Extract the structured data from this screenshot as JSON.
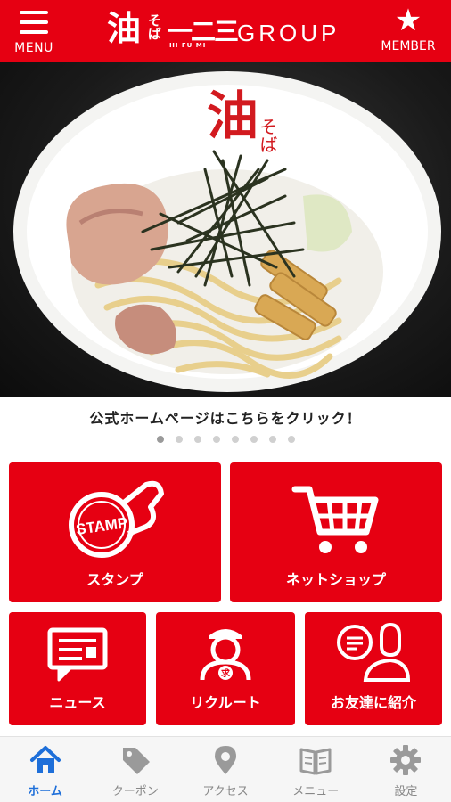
{
  "header": {
    "menu_label": "MENU",
    "logo_kanji": "油",
    "logo_sub": "そば",
    "logo_number": "一二三",
    "logo_romaji": "HI FU MI",
    "logo_group": "GROUP",
    "member_label": "MEMBER",
    "bg_color": "#e60012"
  },
  "hero": {
    "bowl_text_kanji": "油",
    "bowl_text_kana": "そば"
  },
  "banner": {
    "caption": "公式ホームページはこちらをクリック！",
    "dots_total": 8,
    "dots_active": 0
  },
  "tiles": {
    "stamp": {
      "label": "スタンプ",
      "icon_text": "STAMP"
    },
    "shop": {
      "label": "ネットショップ"
    },
    "news": {
      "label": "ニュース"
    },
    "recruit": {
      "label": "リクルート",
      "icon_text": "求"
    },
    "invite": {
      "label": "お友達に紹介"
    }
  },
  "nav": {
    "items": [
      {
        "label": "ホーム",
        "icon": "home-icon",
        "active": true
      },
      {
        "label": "クーポン",
        "icon": "tag-icon",
        "active": false
      },
      {
        "label": "アクセス",
        "icon": "map-pin-icon",
        "active": false
      },
      {
        "label": "メニュー",
        "icon": "book-icon",
        "active": false
      },
      {
        "label": "設定",
        "icon": "gear-icon",
        "active": false
      }
    ],
    "active_color": "#1e6fd9",
    "inactive_color": "#9a9a9a"
  }
}
